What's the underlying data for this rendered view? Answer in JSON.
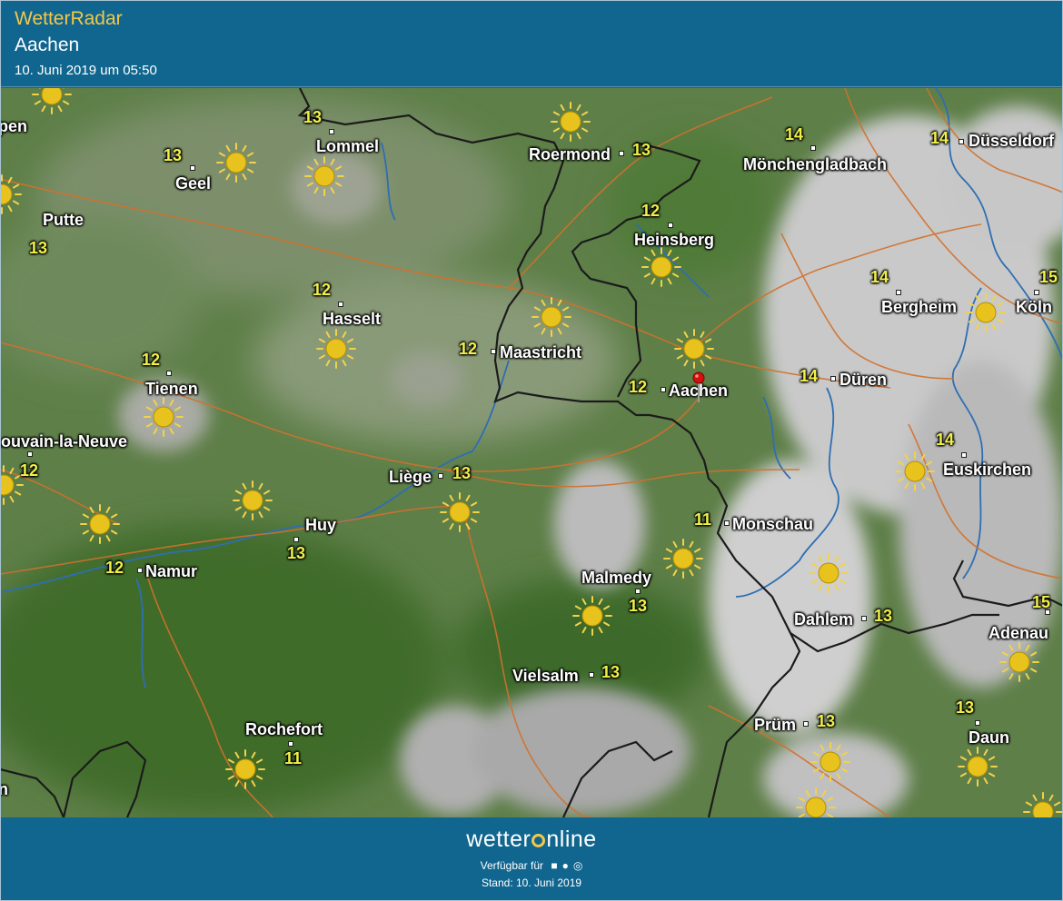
{
  "header": {
    "app_name": "WetterRadar",
    "location": "Aachen",
    "datetime": "10. Juni 2019 um 05:50"
  },
  "colors": {
    "header_bg": "#10668f",
    "brand_yellow": "#f2c84b",
    "temperature_yellow": "#f1f04a",
    "terrain_green": "#5d7e48",
    "cloud_grey": "#bdbdbd",
    "road_orange": "#d9772f",
    "river_blue": "#2d6fb5",
    "border_black": "#1a1a1a",
    "pin_red": "#d41010"
  },
  "map": {
    "cities": [
      {
        "name": "Lommel",
        "temp": "13"
      },
      {
        "name": "Geel",
        "temp": "13"
      },
      {
        "name": "Putte",
        "temp": "13"
      },
      {
        "name": "Roermond",
        "temp": "13"
      },
      {
        "name": "Mönchengladbach",
        "temp": "14"
      },
      {
        "name": "Düsseldorf",
        "temp": "14"
      },
      {
        "name": "Heinsberg",
        "temp": "12"
      },
      {
        "name": "Bergheim",
        "temp": "14"
      },
      {
        "name": "Köln",
        "temp": "15"
      },
      {
        "name": "Hasselt",
        "temp": "12"
      },
      {
        "name": "Maastricht",
        "temp": "12"
      },
      {
        "name": "Aachen",
        "temp": "12"
      },
      {
        "name": "Düren",
        "temp": "14"
      },
      {
        "name": "Tienen",
        "temp": "12"
      },
      {
        "name": "Louvain-la-Neuve",
        "temp": "12"
      },
      {
        "name": "Liège",
        "temp": "13"
      },
      {
        "name": "Euskirchen",
        "temp": "14"
      },
      {
        "name": "Huy",
        "temp": "13"
      },
      {
        "name": "Monschau",
        "temp": "11"
      },
      {
        "name": "Namur",
        "temp": "12"
      },
      {
        "name": "Malmedy",
        "temp": "13"
      },
      {
        "name": "Dahlem",
        "temp": "13"
      },
      {
        "name": "Adenau",
        "temp": "15"
      },
      {
        "name": "Vielsalm",
        "temp": "13"
      },
      {
        "name": "Rochefort",
        "temp": "11"
      },
      {
        "name": "Prüm",
        "temp": "13"
      },
      {
        "name": "Daun",
        "temp": "13"
      }
    ],
    "edge_labels": [
      "pen",
      "n"
    ],
    "weather_icon": "sun-icon",
    "marker_icon": "location-pin-icon"
  },
  "footer": {
    "brand_pre": "wetter",
    "brand_post": "nline",
    "available_label": "Verfügbar für",
    "platform_icons": [
      "android-icon",
      "apple-icon",
      "web-icon"
    ],
    "stand": "Stand: 10. Juni 2019"
  }
}
